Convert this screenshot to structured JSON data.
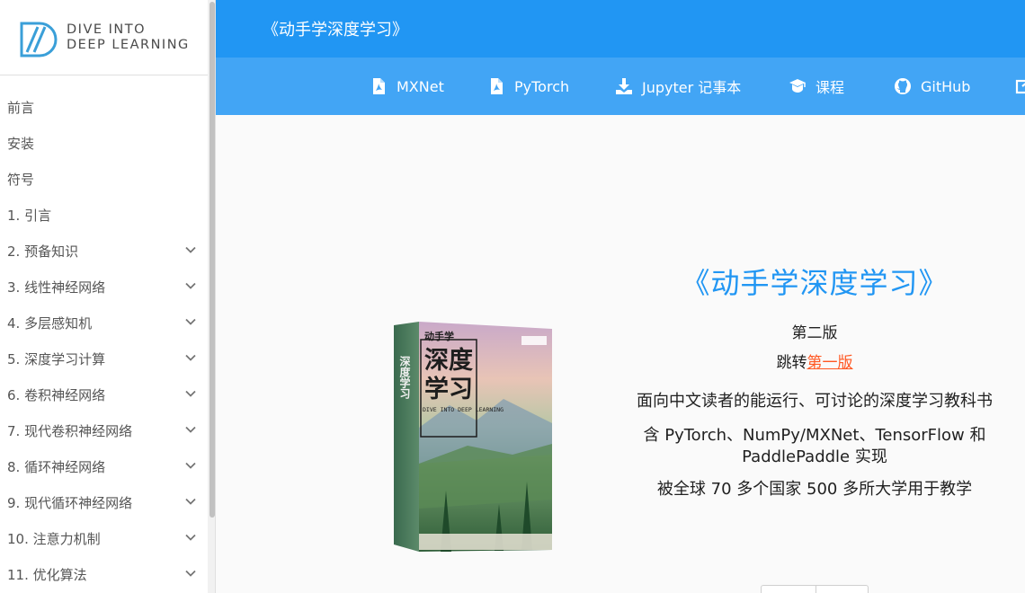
{
  "logo": {
    "line1": "DIVE INTO",
    "line2": "DEEP LEARNING"
  },
  "colors": {
    "primary": "#2196f3",
    "navbar": "#42a5f5",
    "link": "#ff5722"
  },
  "sidebar": {
    "items": [
      {
        "label": "前言",
        "expandable": false
      },
      {
        "label": "安装",
        "expandable": false
      },
      {
        "label": "符号",
        "expandable": false
      },
      {
        "label": "1. 引言",
        "expandable": false
      },
      {
        "label": "2. 预备知识",
        "expandable": true
      },
      {
        "label": "3. 线性神经网络",
        "expandable": true
      },
      {
        "label": "4. 多层感知机",
        "expandable": true
      },
      {
        "label": "5. 深度学习计算",
        "expandable": true
      },
      {
        "label": "6. 卷积神经网络",
        "expandable": true
      },
      {
        "label": "7. 现代卷积神经网络",
        "expandable": true
      },
      {
        "label": "8. 循环神经网络",
        "expandable": true
      },
      {
        "label": "9. 现代循环神经网络",
        "expandable": true
      },
      {
        "label": "10. 注意力机制",
        "expandable": true
      },
      {
        "label": "11. 优化算法",
        "expandable": true
      }
    ]
  },
  "header": {
    "title": "《动手学深度学习》"
  },
  "navbar": {
    "links": [
      {
        "label": "MXNet",
        "icon": "pdf-file-icon"
      },
      {
        "label": "PyTorch",
        "icon": "pdf-file-icon"
      },
      {
        "label": "Jupyter 记事本",
        "icon": "download-icon"
      },
      {
        "label": "课程",
        "icon": "graduation-cap-icon"
      },
      {
        "label": "GitHub",
        "icon": "github-icon"
      }
    ]
  },
  "hero": {
    "title": "《动手学深度学习》",
    "edition": "第二版",
    "redirect_prefix": "跳转",
    "redirect_link": "第一版",
    "desc1": "面向中文读者的能运行、可讨论的深度学习教科书",
    "desc2": "含 PyTorch、NumPy/MXNet、TensorFlow 和 PaddlePaddle 实现",
    "desc3": "被全球 70 多个国家 500 多所大学用于教学"
  },
  "book": {
    "title_small": "动手学",
    "title_large_1": "深度",
    "title_large_2": "学习",
    "subtitle_en": "DIVE INTO DEEP LEARNING"
  }
}
